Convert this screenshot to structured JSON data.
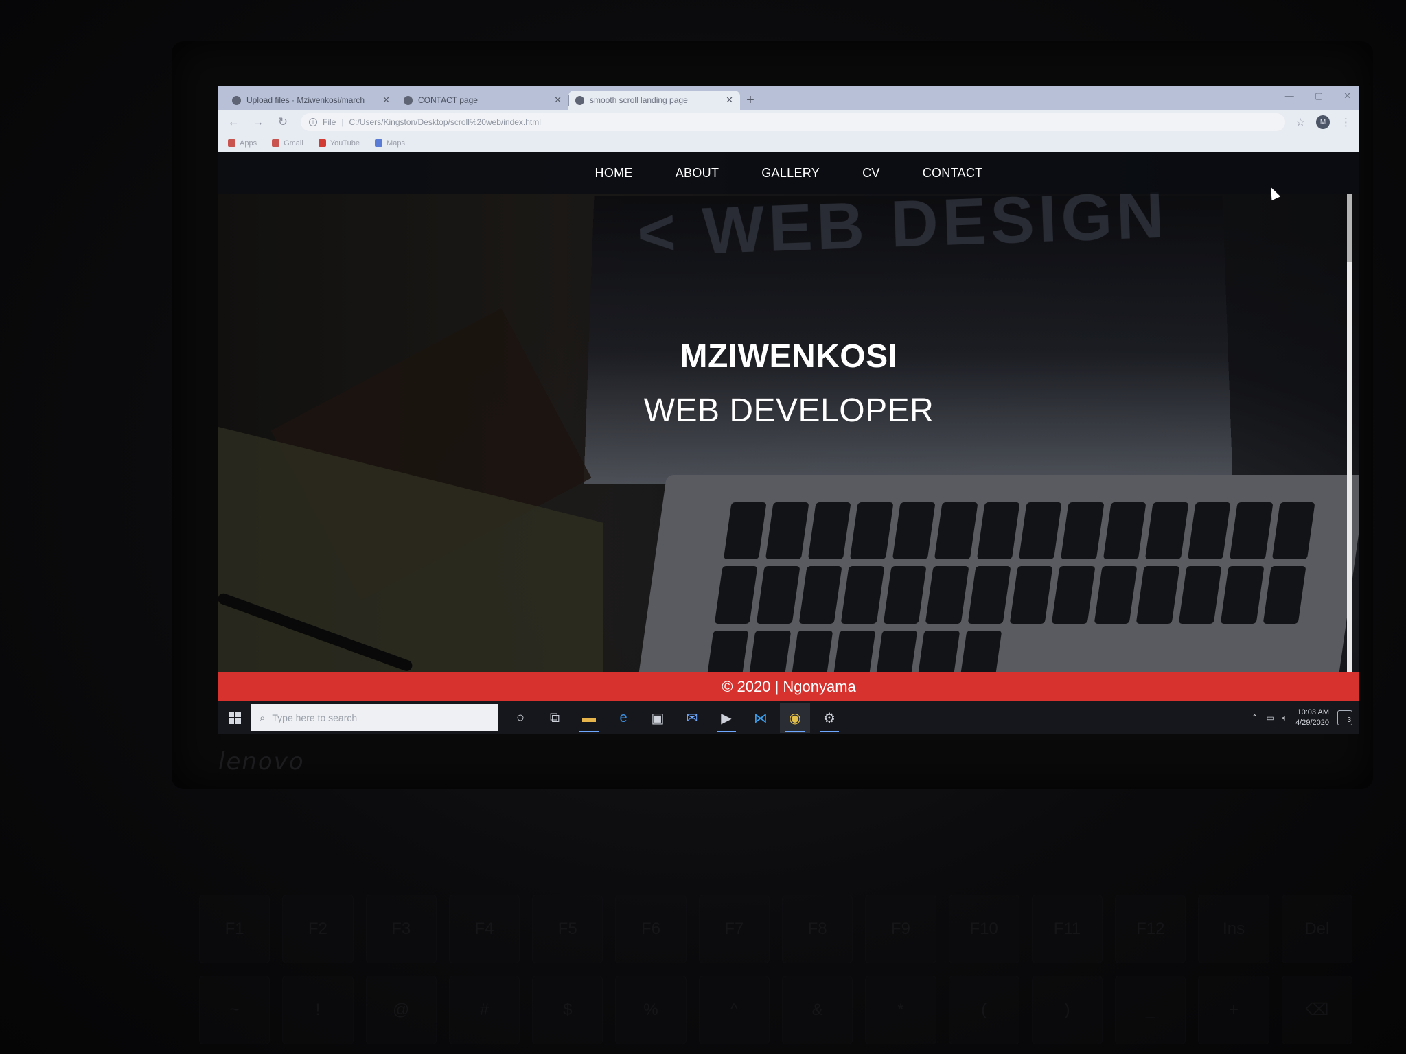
{
  "device": {
    "brand": "lenovo"
  },
  "browser": {
    "tabs": [
      {
        "title": "Upload files · Mziwenkosi/march",
        "active": false
      },
      {
        "title": "CONTACT page",
        "active": false
      },
      {
        "title": "smooth scroll landing page",
        "active": true
      }
    ],
    "new_tab_label": "+",
    "url_prefix": "File",
    "url": "C:/Users/Kingston/Desktop/scroll%20web/index.html",
    "profile_initial": "M",
    "bookmarks": [
      {
        "label": "Apps",
        "icon": "apps-grid-icon",
        "color": "#c9534f"
      },
      {
        "label": "Gmail",
        "icon": "gmail-icon",
        "color": "#c9534f"
      },
      {
        "label": "YouTube",
        "icon": "youtube-icon",
        "color": "#d23b34"
      },
      {
        "label": "Maps",
        "icon": "maps-icon",
        "color": "#5a7bd6"
      }
    ]
  },
  "site": {
    "nav": [
      "HOME",
      "ABOUT",
      "GALLERY",
      "CV",
      "CONTACT"
    ],
    "background_lettering": "< WEB DESIGN",
    "hero": {
      "name": "MZIWENKOSI",
      "role": "WEB DEVELOPER"
    },
    "footer": "© 2020 | Ngonyama",
    "colors": {
      "footer": "#d8322e",
      "nav_bg": "#0a0c12",
      "text": "#ffffff"
    }
  },
  "taskbar": {
    "search_placeholder": "Type here to search",
    "apps": [
      {
        "name": "cortana-icon",
        "glyph": "○"
      },
      {
        "name": "task-view-icon",
        "glyph": "⧉"
      },
      {
        "name": "file-explorer-icon",
        "glyph": "▬"
      },
      {
        "name": "edge-icon",
        "glyph": "e"
      },
      {
        "name": "store-icon",
        "glyph": "▣"
      },
      {
        "name": "mail-icon",
        "glyph": "✉"
      },
      {
        "name": "media-icon",
        "glyph": "▶"
      },
      {
        "name": "vscode-icon",
        "glyph": "⋈"
      },
      {
        "name": "chrome-icon",
        "glyph": "◉"
      },
      {
        "name": "settings-icon",
        "glyph": "⚙"
      }
    ],
    "time": "10:03 AM",
    "date": "4/29/2020",
    "notification_count": "3"
  }
}
